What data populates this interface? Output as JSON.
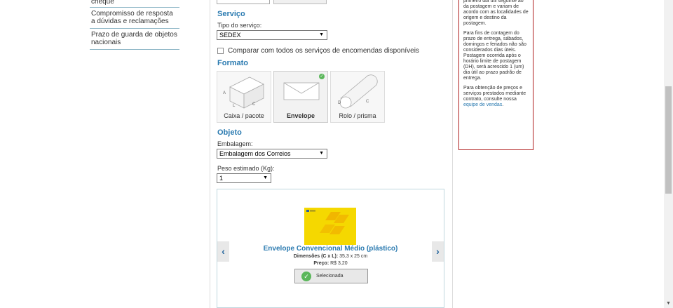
{
  "sidebar": {
    "items": [
      {
        "label": "cheque"
      },
      {
        "label": "Compromisso de resposta a dúvidas e reclamações"
      },
      {
        "label": "Prazo de guarda de objetos nacionais"
      }
    ]
  },
  "servico": {
    "title": "Serviço",
    "tipo_label": "Tipo do serviço:",
    "tipo_value": "SEDEX",
    "compare_label": "Comparar com todos os serviços de encomendas disponíveis"
  },
  "formato": {
    "title": "Formato",
    "cards": [
      {
        "label": "Caixa / pacote",
        "selected": false
      },
      {
        "label": "Envelope",
        "selected": true
      },
      {
        "label": "Rolo / prisma",
        "selected": false
      }
    ]
  },
  "objeto": {
    "title": "Objeto",
    "embalagem_label": "Embalagem:",
    "embalagem_value": "Embalagem dos Correios",
    "peso_label": "Peso estimado (Kg):",
    "peso_value": "1"
  },
  "carousel": {
    "product_name": "Envelope Convencional Médio (plástico)",
    "dim_label": "Dimensões (C x L):",
    "dim_value": "35,3 x 25 cm",
    "price_label": "Preço:",
    "price_value": "R$ 3,20",
    "selected_label": "Selecionada",
    "prev_icon": "chevron-left-icon",
    "next_icon": "chevron-right-icon"
  },
  "info": {
    "p1": "primeiro dia útil seguinte ao da postagem e variam de acordo com as localidades de origem e destino da postagem.",
    "p2": "Para fins de contagem do prazo de entrega, sábados, domingos e feriados não são considerados dias úteis. Postagem ocorrida após o horário limite de postagem (DH), será acrescido 1 (um) dia útil ao prazo padrão de entrega.",
    "p3_text": "Para obtenção de preços e serviços prestados mediante contrato, consulte nossa ",
    "p3_link": "equipe de vendas",
    "p3_end": "."
  },
  "colors": {
    "accent": "#2a7ab0",
    "info_border": "#b02020",
    "envelope_yellow": "#f5d800",
    "selected_green": "#5bb75b"
  }
}
